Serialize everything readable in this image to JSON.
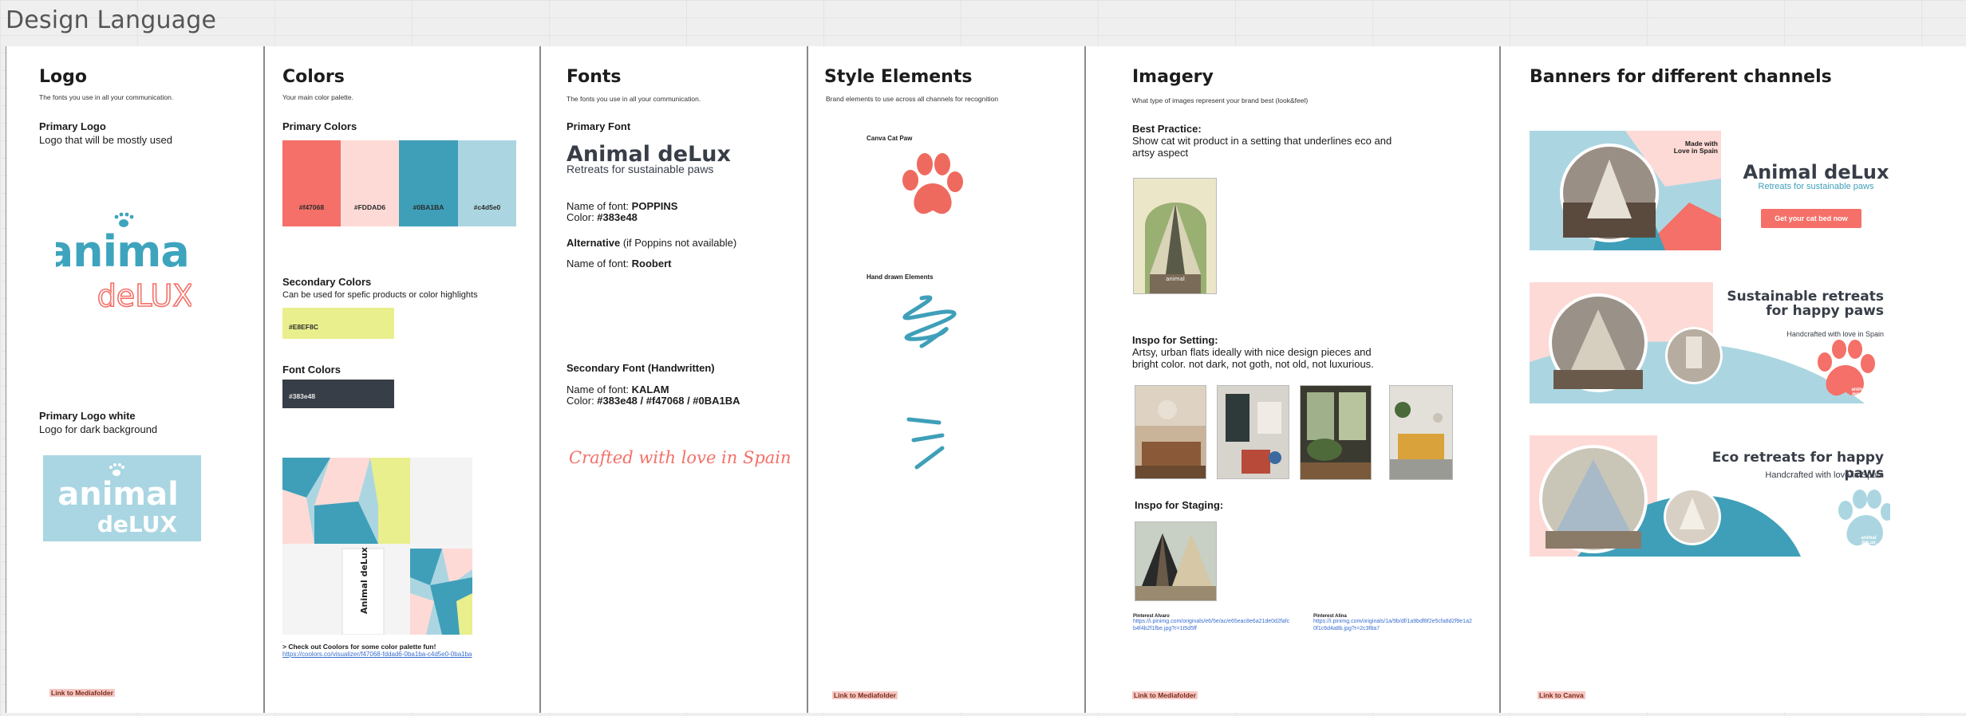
{
  "board": {
    "title": "Design Language"
  },
  "colors_hex": {
    "coral": "#f47068",
    "pink": "#FDDAD6",
    "teal": "#0BA1BA",
    "lightblue": "#c4d5e0",
    "yellow": "#E8EF8C",
    "dark": "#383e48"
  },
  "logo": {
    "heading": "Logo",
    "subtitle": "The fonts you use in all your communication.",
    "primary_heading": "Primary Logo",
    "primary_desc": "Logo that will be mostly used",
    "logo_word1": "animal",
    "logo_word2": "deLUX",
    "white_heading": "Primary Logo white",
    "white_desc": "Logo for dark background",
    "link": "Link to Mediafolder"
  },
  "colors": {
    "heading": "Colors",
    "subtitle": "Your main color palette.",
    "primary_heading": "Primary Colors",
    "primary": [
      {
        "hex": "#f47068",
        "label": "#f47068"
      },
      {
        "hex": "#FDDAD6",
        "label": "#FDDAD6"
      },
      {
        "hex": "#0BA1BA",
        "label": "#0BA1BA"
      },
      {
        "hex": "#c4d5e0",
        "label": "#c4d5e0"
      }
    ],
    "secondary_heading": "Secondary Colors",
    "secondary_desc": "Can be used for spefic products or color highlights",
    "secondary_label": "#E8EF8C",
    "font_heading": "Font Colors",
    "font_label": "#383e48",
    "mock_text": "Animal deLux",
    "coolors_note": "> Check out Coolors for some color palette fun!",
    "coolors_url": "https://coolors.co/visualizer/f47068-fddad6-0ba1ba-c4d5e0-0ba1ba"
  },
  "fonts": {
    "heading": "Fonts",
    "subtitle": "The fonts you use in all your communication.",
    "primary_heading": "Primary Font",
    "sample_title": "Animal deLux",
    "sample_sub": "Retreats for sustainable paws",
    "name_label": "Name of font: ",
    "name_value": "POPPINS",
    "color_label": "Color: ",
    "color_value": "#383e48",
    "alt_bold": "Alternative",
    "alt_rest": " (if Poppins not available)",
    "alt_name_label": "Name of font: ",
    "alt_name_value": "Roobert",
    "secondary_heading": "Secondary Font (Handwritten)",
    "sec_name_label": "Name of font: ",
    "sec_name_value": "KALAM",
    "sec_color_label": "Color: ",
    "sec_color_value": "#383e48 / #f47068 / #0BA1BA",
    "handwritten_sample": "Crafted with love in Spain"
  },
  "style": {
    "heading": "Style Elements",
    "subtitle": "Brand elements to use across all channels for recognition",
    "paw_label": "Canva Cat Paw",
    "hand_label": "Hand drawn Elements",
    "link": "Link to Mediafolder"
  },
  "imagery": {
    "heading": "Imagery",
    "subtitle": "What type of images represent your brand best (look&feel)",
    "best_heading": "Best Practice:",
    "best_desc": "Show cat wit product in a setting that underlines eco and artsy aspect",
    "setting_heading": "Inspo for Setting:",
    "setting_desc": "Artsy, urban flats ideally with nice design pieces and bright color. not dark, not goth, not old, not luxurious.",
    "staging_heading": "Inspo for Staging:",
    "photo_caption": "animal",
    "pin1_title": "Pinterest Alvaro",
    "pin1_url": "https://i.pinimg.com/originals/e6/5e/ac/e65eac8e6a21de0d2fafcb4f4b2f1fbe.jpg?r=1t5d5ff",
    "pin2_title": "Pinterest Alina",
    "pin2_url": "https://i.pinimg.com/originals/1a/9b/df/1a9bdf8f2e5cfa8d2f9e1a20f1c6d4a8b.jpg?r=2c3f8a7",
    "link": "Link to Mediafolder"
  },
  "banners": {
    "heading": "Banners for different channels",
    "b1_tag": "Made with Love in Spain",
    "b1_title": "Animal deLux",
    "b1_sub": "Retreats for sustainable paws",
    "b1_button": "Get your cat bed now",
    "b2_title": "Sustainable retreats for happy paws",
    "b2_sub": "Handcrafted with love in Spain",
    "b2_badge": "animal deLux",
    "b3_title": "Eco retreats for happy paws",
    "b3_sub": "Handcrafted with love in Spain",
    "b3_badge": "animal deLux",
    "link": "Link to Canva"
  }
}
